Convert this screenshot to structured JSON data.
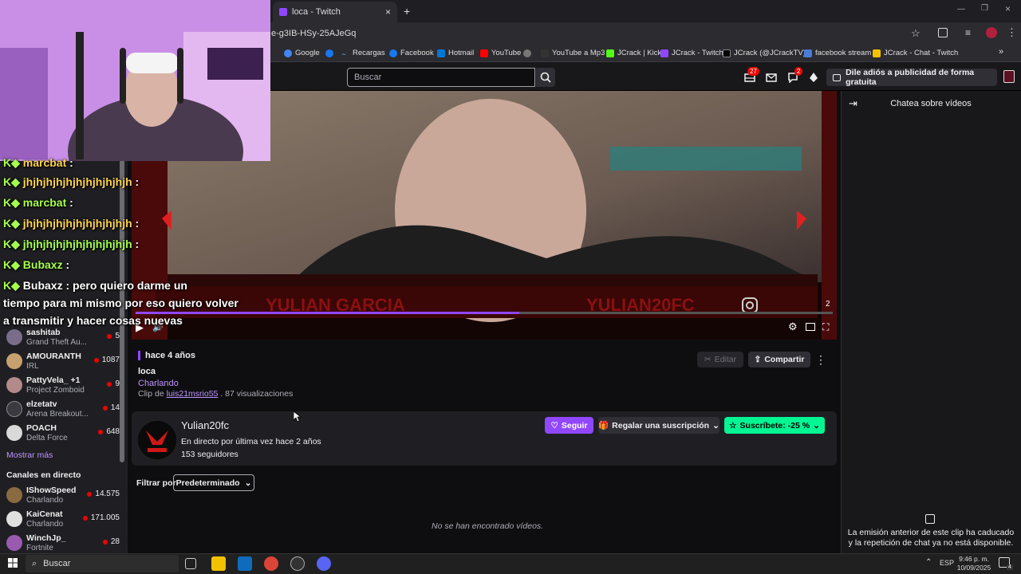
{
  "browser": {
    "tab_title": "loca - Twitch",
    "url": "e-g3IB-HSy-25AJeGq",
    "bookmarks": [
      "Google",
      "Facebook",
      "Recargas",
      "Facebook",
      "Hotmail",
      "YouTube",
      "YouTube a Mp3",
      "JCrack | Kick",
      "JCrack - Twitch",
      "JCrack (@JCrackTV)...",
      "facebook stream",
      "JCrack - Chat - Twitch"
    ]
  },
  "topnav": {
    "search_placeholder": "Buscar",
    "inbox_count": "27",
    "whispers_count": "2",
    "ad_button": "Dile adiós a publicidad de forma gratuita"
  },
  "sidebar": {
    "followed": [
      {
        "name": "sashitab",
        "category": "Grand Theft Au...",
        "viewers": "5"
      },
      {
        "name": "AMOURANTH",
        "category": "IRL",
        "viewers": "1087"
      },
      {
        "name": "PattyVela_ +1",
        "category": "Project Zomboid",
        "viewers": "9"
      },
      {
        "name": "elzetatv",
        "category": "Arena Breakout...",
        "viewers": "14"
      },
      {
        "name": "POACH",
        "category": "Delta Force",
        "viewers": "648"
      }
    ],
    "show_more": "Mostrar más",
    "live_header": "Canales en directo",
    "live": [
      {
        "name": "IShowSpeed",
        "category": "Charlando",
        "viewers": "14.575"
      },
      {
        "name": "KaiCenat",
        "category": "Charlando",
        "viewers": "171.005"
      },
      {
        "name": "WinchJp_",
        "category": "Fortnite",
        "viewers": "28"
      }
    ]
  },
  "overlay_chat": [
    {
      "user": "marcbat",
      "text": ""
    },
    {
      "user": "jhjhjhjhjhjhjhjhjhjhjh",
      "text": ""
    },
    {
      "user": "marcbat",
      "text": ""
    },
    {
      "user": "jhjhjhjhjhjhjhjhjhjhjh",
      "text": ""
    },
    {
      "user": "jhjhjhjhjhjhjhjhjhjhjh",
      "text": ""
    },
    {
      "user": "Bubaxz",
      "text": "pero quiero darme un"
    },
    {
      "user": "",
      "text": "tiempo para mi mismo por eso quiero volver"
    },
    {
      "user": "",
      "text": "a transmitir y hacer cosas nuevas"
    }
  ],
  "video": {
    "overlay_left_text": "YULIAN GARCIA",
    "overlay_right_text": "YULIAN20FC",
    "counter": "2",
    "progress": 0.55
  },
  "clip": {
    "age": "hace 4 años",
    "title": "loca",
    "category": "Charlando",
    "by_prefix": "Clip de",
    "by_user": "luis21msrio55",
    "views": ". 87 visualizaciones",
    "edit_label": "Editar",
    "share_label": "Compartir"
  },
  "channel": {
    "name": "Yulian20fc",
    "last_live": "En directo por última vez hace 2 años",
    "followers": "153 seguidores",
    "follow_label": "Seguir",
    "gift_label": "Regalar una suscripción",
    "sub_label": "Suscríbete: -25 %"
  },
  "filter": {
    "label": "Filtrar por",
    "value": "Predeterminado",
    "empty": "No se han encontrado vídeos."
  },
  "chat": {
    "title": "Chatea sobre vídeos",
    "message": "La emisión anterior de este clip ha caducado y la repetición de chat ya no está disponible."
  },
  "taskbar": {
    "search": "Buscar",
    "lang": "ESP",
    "time": "9:46 p. m.",
    "date": "10/09/2025",
    "notif": "4"
  },
  "colors": {
    "twitch_purple": "#9147ff",
    "sub_green": "#00f593",
    "live_red": "#eb0400"
  }
}
